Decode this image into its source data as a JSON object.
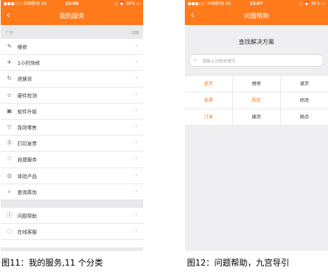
{
  "left": {
    "status": {
      "carrier": "●●●○○ 中国移动 4G",
      "time": "23:08",
      "battery": "○ ⏰ 38% ▭"
    },
    "title": "我的服务",
    "region_left": "广东",
    "region_right": "切换",
    "items": [
      {
        "label": "维修",
        "icon": "wrench-icon"
      },
      {
        "label": "1小时快修",
        "icon": "plane-icon"
      },
      {
        "label": "退换货",
        "icon": "refresh-icon"
      },
      {
        "label": "硬件检测",
        "icon": "phone-icon"
      },
      {
        "label": "软件升级",
        "icon": "upgrade-icon"
      },
      {
        "label": "现场零售",
        "icon": "cart-icon"
      },
      {
        "label": "打印发票",
        "icon": "invoice-icon"
      },
      {
        "label": "自提服务",
        "icon": "pickup-icon"
      },
      {
        "label": "体验产品",
        "icon": "eye-icon"
      },
      {
        "label": "查询真伪",
        "icon": "search-icon"
      }
    ],
    "items2": [
      {
        "label": "问题帮助",
        "icon": "help-icon"
      },
      {
        "label": "在线客服",
        "icon": "chat-icon"
      }
    ]
  },
  "right": {
    "status": {
      "carrier": "●●●○○ 中国移动 4G",
      "time": "23:07",
      "battery": "○ ⏰ 38% ▭"
    },
    "title": "问题帮助",
    "section_title": "查找解决方案",
    "search_placeholder": "请输入问题关键字",
    "grid": [
      [
        {
          "label": "发货",
          "orange": true
        },
        {
          "label": "维修",
          "orange": false
        },
        {
          "label": "退货",
          "orange": false
        }
      ],
      [
        {
          "label": "发票",
          "orange": true
        },
        {
          "label": "购买",
          "orange": true
        },
        {
          "label": "修改",
          "orange": false
        }
      ],
      [
        {
          "label": "订单",
          "orange": true
        },
        {
          "label": "换货",
          "orange": false
        },
        {
          "label": "网点",
          "orange": false
        }
      ]
    ]
  },
  "captions": {
    "left": "图11：我的服务,11 个分类",
    "right": "图12：问题帮助，九宫导引"
  },
  "colors": {
    "accent": "#ff7a1a",
    "background": "#efeff1"
  }
}
